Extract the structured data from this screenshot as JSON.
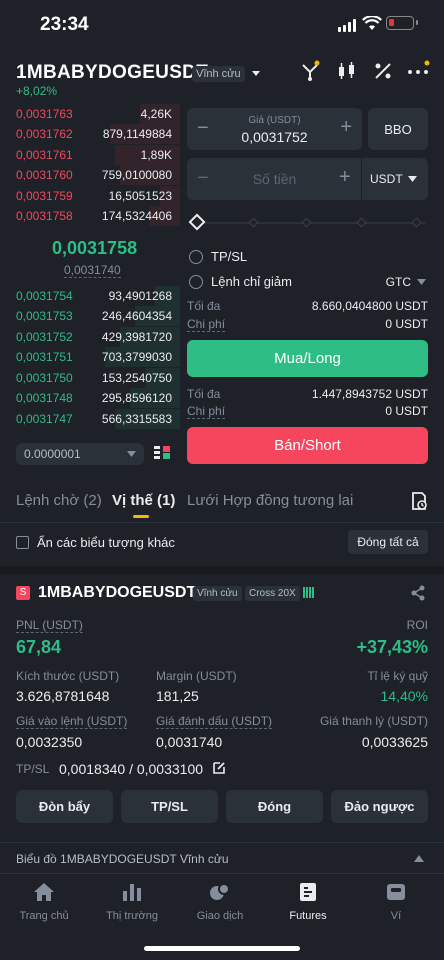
{
  "status": {
    "time": "23:34"
  },
  "header": {
    "symbol": "1MBABYDOGEUSDT",
    "contract_tag": "Vĩnh cửu",
    "change": "+8,02%"
  },
  "orderbook": {
    "asks": [
      {
        "price": "0,0031763",
        "qty": "4,26K"
      },
      {
        "price": "0,0031762",
        "qty": "879,1149884"
      },
      {
        "price": "0,0031761",
        "qty": "1,89K"
      },
      {
        "price": "0,0031760",
        "qty": "759,0100080"
      },
      {
        "price": "0,0031759",
        "qty": "16,5051523"
      },
      {
        "price": "0,0031758",
        "qty": "174,5324406"
      }
    ],
    "last_price": "0,0031758",
    "mark_price": "0,0031740",
    "bids": [
      {
        "price": "0,0031754",
        "qty": "93,4901268"
      },
      {
        "price": "0,0031753",
        "qty": "246,4604354"
      },
      {
        "price": "0,0031752",
        "qty": "429,3981720"
      },
      {
        "price": "0,0031751",
        "qty": "703,3799030"
      },
      {
        "price": "0,0031750",
        "qty": "153,2540750"
      },
      {
        "price": "0,0031748",
        "qty": "295,8596120"
      },
      {
        "price": "0,0031747",
        "qty": "566,3315583"
      }
    ],
    "precision": "0.0000001"
  },
  "order_form": {
    "price_label": "Giá (USDT)",
    "price_value": "0,0031752",
    "bbo": "BBO",
    "amount_placeholder": "Số tiền",
    "amount_unit": "USDT",
    "slider_value_percent": 0,
    "tpsl": "TP/SL",
    "reduce_only": "Lệnh chỉ giảm",
    "tif": "GTC",
    "buy": {
      "max_label": "Tối đa",
      "max_value": "8.660,0404800 USDT",
      "cost_label": "Chi phí",
      "cost_value": "0 USDT",
      "button": "Mua/Long"
    },
    "sell": {
      "max_label": "Tối đa",
      "max_value": "1.447,8943752 USDT",
      "cost_label": "Chi phí",
      "cost_value": "0 USDT",
      "button": "Bán/Short"
    }
  },
  "tabs": [
    {
      "label": "Lệnh chờ (2)"
    },
    {
      "label": "Vị thế (1)"
    },
    {
      "label": "Lưới Hợp đồng tương lai"
    }
  ],
  "filter": {
    "hide_others": "Ẩn các biểu tượng khác",
    "close_all": "Đóng tất cả"
  },
  "position": {
    "side_badge": "S",
    "symbol": "1MBABYDOGEUSDT",
    "contract_tag": "Vĩnh cửu",
    "margin_tag": "Cross 20X",
    "pnl_label": "PNL (USDT)",
    "pnl_value": "67,84",
    "roi_label": "ROI",
    "roi_value": "+37,43%",
    "size_label": "Kích thước (USDT)",
    "size_value": "3.626,8781648",
    "margin_label": "Margin (USDT)",
    "margin_value": "181,25",
    "margin_ratio_label": "Tỉ lệ ký quỹ",
    "margin_ratio_value": "14,40%",
    "entry_label": "Giá vào lệnh (USDT)",
    "entry_value": "0,0032350",
    "mark_label": "Giá đánh dấu (USDT)",
    "mark_value": "0,0031740",
    "liq_label": "Giá thanh lý (USDT)",
    "liq_value": "0,0033625",
    "tpsl_label": "TP/SL",
    "tpsl_value": "0,0018340 / 0,0033100",
    "actions": [
      "Đòn bẩy",
      "TP/SL",
      "Đóng",
      "Đảo ngược"
    ]
  },
  "chart_bar": {
    "label": "Biểu đồ 1MBABYDOGEUSDT Vĩnh cửu"
  },
  "nav": [
    {
      "label": "Trang chủ",
      "icon": "home-icon"
    },
    {
      "label": "Thị trường",
      "icon": "market-icon"
    },
    {
      "label": "Giao dịch",
      "icon": "trade-icon"
    },
    {
      "label": "Futures",
      "icon": "futures-icon"
    },
    {
      "label": "Ví",
      "icon": "wallet-icon"
    }
  ],
  "colors": {
    "green": "#2ebd85",
    "red": "#f6465d",
    "accent": "#f0b90b",
    "bg": "#1e2128"
  }
}
